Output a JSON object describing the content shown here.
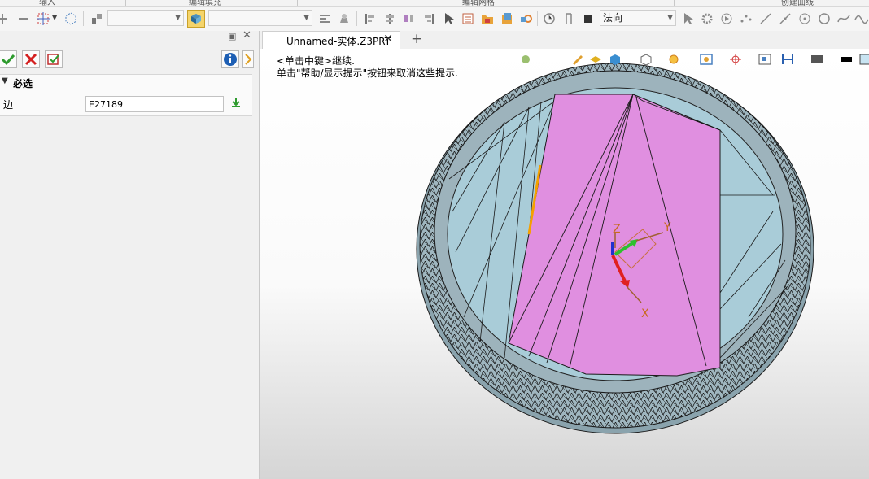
{
  "ribbon": {
    "labels": [
      "输入",
      "编辑填充",
      "编辑网格",
      "创建曲线"
    ]
  },
  "toolbar": {
    "combo_1": "",
    "combo_2": "",
    "combo_3": "法向"
  },
  "document": {
    "tab_title": "Unnamed-实体.Z3PRT",
    "close_glyph": "✕",
    "new_tab_glyph": "+"
  },
  "hints": {
    "line1": "<单击中键>继续.",
    "line2": "单击\"帮助/显示提示\"按钮来取消这些提示."
  },
  "left_panel": {
    "section_title": "必选",
    "edge_label": "边",
    "edge_value": "E27189"
  },
  "triad": {
    "x_label": "X",
    "y_label": "Y",
    "z_label": "Z"
  },
  "colors": {
    "face_highlight": "#e08fe0",
    "inner_wall": "#a9ccd8",
    "mesh_rim": "#9fb6bf",
    "selected_edge": "#f5a000",
    "ok_green": "#2e9b2e",
    "cancel_red": "#d42020"
  }
}
